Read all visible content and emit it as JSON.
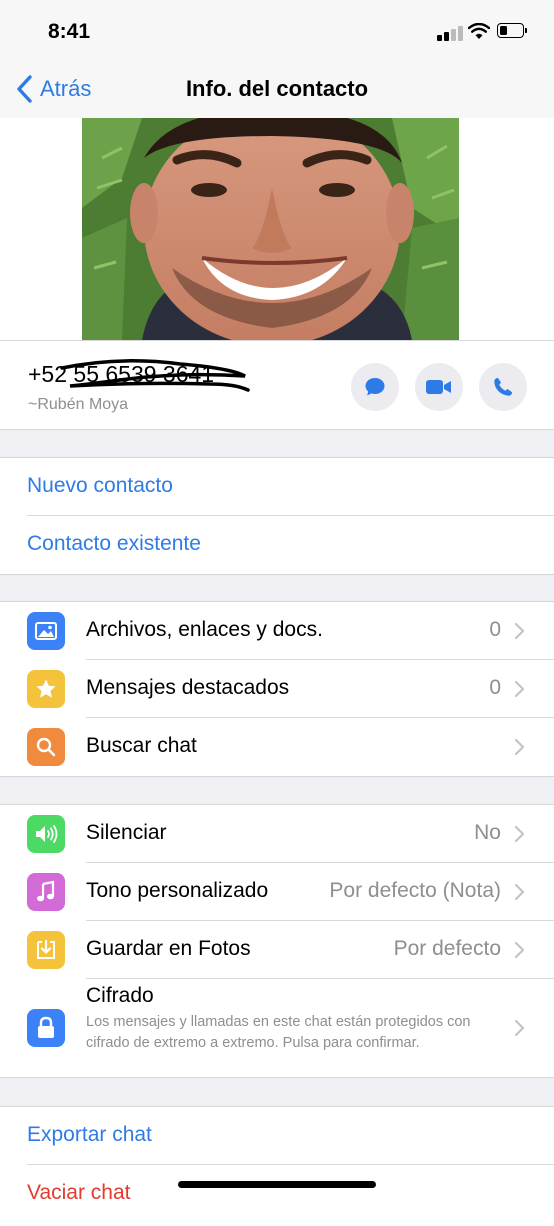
{
  "status_bar": {
    "time": "8:41"
  },
  "nav": {
    "back_label": "Atrás",
    "title": "Info. del contacto"
  },
  "contact": {
    "phone": "+52 55 6539 3641",
    "name": "~Rubén Moya"
  },
  "contact_actions": [
    "message-icon",
    "video-icon",
    "phone-icon"
  ],
  "links_group": {
    "new_contact": "Nuevo contacto",
    "existing_contact": "Contacto existente"
  },
  "media_group": [
    {
      "label": "Archivos, enlaces y docs.",
      "value": "0",
      "icon": "photo-icon",
      "color": "#3b82f6"
    },
    {
      "label": "Mensajes destacados",
      "value": "0",
      "icon": "star-icon",
      "color": "#f5c33b"
    },
    {
      "label": "Buscar chat",
      "value": "",
      "icon": "search-icon",
      "color": "#f08a3e"
    }
  ],
  "settings_group": {
    "mute": {
      "label": "Silenciar",
      "value": "No",
      "icon": "speaker-icon",
      "color": "#4cd964"
    },
    "tone": {
      "label": "Tono personalizado",
      "value": "Por defecto (Nota)",
      "icon": "music-note-icon",
      "color": "#d26ad8"
    },
    "save_photos": {
      "label": "Guardar en Fotos",
      "value": "Por defecto",
      "icon": "download-icon",
      "color": "#f5c33b"
    },
    "encryption": {
      "label": "Cifrado",
      "description": "Los mensajes y llamadas en este chat están protegidos con cifrado de extremo a extremo. Pulsa para confirmar.",
      "icon": "lock-icon",
      "color": "#3b82f6"
    }
  },
  "export_group": {
    "export_chat": "Exportar chat",
    "clear_chat": "Vaciar chat"
  }
}
